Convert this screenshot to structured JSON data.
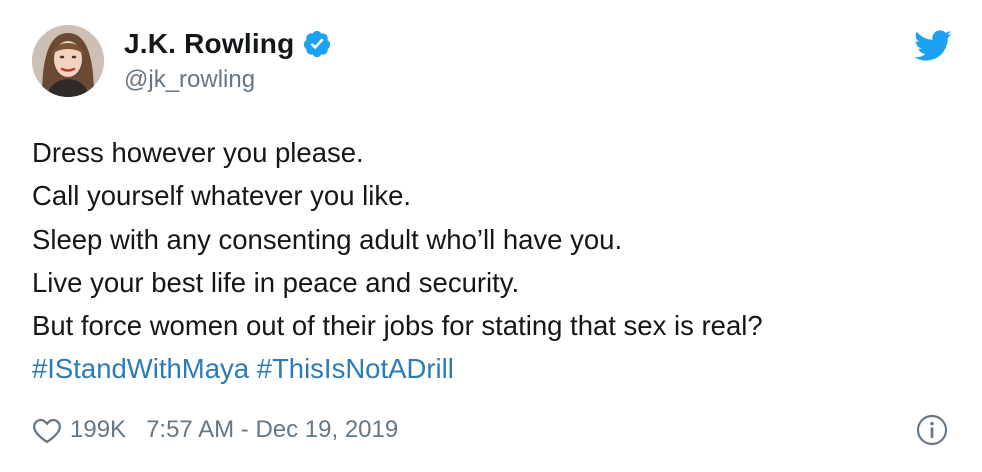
{
  "user": {
    "display_name": "J.K. Rowling",
    "handle": "@jk_rowling",
    "verified_icon": "verified-badge-icon",
    "avatar": "profile-photo"
  },
  "brand": {
    "icon": "twitter-bird-icon",
    "color": "#1da1f2"
  },
  "tweet": {
    "lines": [
      "Dress however you please.",
      "Call yourself whatever you like.",
      "Sleep with any consenting adult who’ll have you.",
      "Live your best life in peace and security.",
      "But force women out of their jobs for stating that sex is real?"
    ],
    "hashtags": [
      "#IStandWithMaya",
      "#ThisIsNotADrill"
    ]
  },
  "footer": {
    "like_icon": "heart-icon",
    "like_count": "199K",
    "timestamp": "7:57 AM - Dec 19, 2019",
    "info_icon": "info-icon"
  },
  "colors": {
    "text": "#14171a",
    "muted": "#657786",
    "link": "#2b7bb9",
    "verified": "#1da1f2"
  }
}
